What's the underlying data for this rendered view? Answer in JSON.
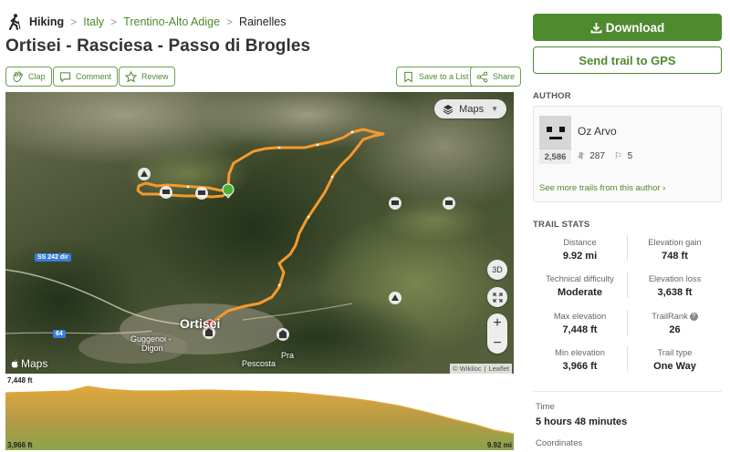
{
  "breadcrumb": {
    "root": "Hiking",
    "links": [
      "Italy",
      "Trentino-Alto Adige"
    ],
    "current": "Rainelles"
  },
  "trail": {
    "title": "Ortisei - Rasciesa - Passo di Brogles"
  },
  "actions": {
    "clap": "Clap",
    "comment": "Comment",
    "review": "Review",
    "save": "Save to a List",
    "share": "Share"
  },
  "map": {
    "layer_button": "Maps",
    "btn_3d": "3D",
    "logo": "Maps",
    "attribution": [
      "© Wikiloc",
      "Leaflet"
    ],
    "labels": {
      "town": "Ortisei",
      "guggenoi": "Guggenoi -",
      "digon": "Digon",
      "pra": "Pra",
      "pescosta": "Pescosta"
    },
    "roads": [
      "SS 242 dir",
      "64"
    ]
  },
  "elevation_profile": {
    "max_label": "7,448 ft",
    "min_label": "3,966 ft",
    "distance_label": "9.92 mi"
  },
  "sidebar": {
    "download": "Download",
    "send_gps": "Send trail to GPS",
    "author_header": "AUTHOR",
    "author": {
      "name": "Oz Arvo",
      "points": "2,586",
      "trails": "287",
      "followers": "5",
      "see_more": "See more trails from this author ›"
    },
    "stats_header": "TRAIL STATS",
    "stats": [
      {
        "k": "Distance",
        "v": "9.92 mi"
      },
      {
        "k": "Elevation gain",
        "v": "748 ft"
      },
      {
        "k": "Technical difficulty",
        "v": "Moderate"
      },
      {
        "k": "Elevation loss",
        "v": "3,638 ft"
      },
      {
        "k": "Max elevation",
        "v": "7,448 ft"
      },
      {
        "k": "TrailRank",
        "v": "26"
      },
      {
        "k": "Min elevation",
        "v": "3,966 ft"
      },
      {
        "k": "Trail type",
        "v": "One Way"
      }
    ],
    "time_label": "Time",
    "time_value": "5 hours 48 minutes",
    "coordinates_label": "Coordinates"
  },
  "colors": {
    "brand_green": "#4e8a2e",
    "track_orange": "#f59a2c",
    "profile_fill": "#c9a043"
  }
}
